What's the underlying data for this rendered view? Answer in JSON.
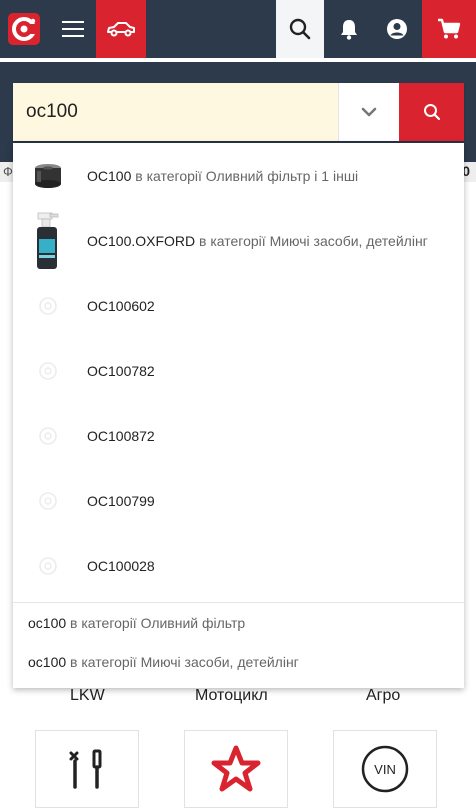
{
  "search": {
    "query": "oc100"
  },
  "strip": {
    "left_text": "Ф",
    "right_text": "0"
  },
  "suggestions": [
    {
      "code": "OC100",
      "category_text": "в категорії Оливний фільтр і 1 інші",
      "thumb": "oil-filter-photo"
    },
    {
      "code": "OC100.OXFORD",
      "category_text": "в категорії Миючі засоби, детейлінг",
      "thumb": "spray-bottle-photo"
    },
    {
      "code": "OC100602",
      "category_text": "",
      "thumb": "placeholder-icon"
    },
    {
      "code": "OC100782",
      "category_text": "",
      "thumb": "placeholder-icon"
    },
    {
      "code": "OC100872",
      "category_text": "",
      "thumb": "placeholder-icon"
    },
    {
      "code": "OC100799",
      "category_text": "",
      "thumb": "placeholder-icon"
    },
    {
      "code": "OC100028",
      "category_text": "",
      "thumb": "placeholder-icon"
    }
  ],
  "category_suggestions": [
    {
      "query": "oc100",
      "category_text": "в категорії Оливний фільтр"
    },
    {
      "query": "oc100",
      "category_text": "в категорії Миючі засоби, детейлінг"
    }
  ],
  "categories": [
    {
      "label": "LKW",
      "icon": "tools-icon"
    },
    {
      "label": "Мотоцикл",
      "icon": "star-icon"
    },
    {
      "label": "Агро",
      "icon": "vin-icon"
    }
  ],
  "vin_badge": "VIN",
  "colors": {
    "header": "#2c3a4c",
    "accent": "#d9232f",
    "input_bg": "#fff8e1"
  }
}
